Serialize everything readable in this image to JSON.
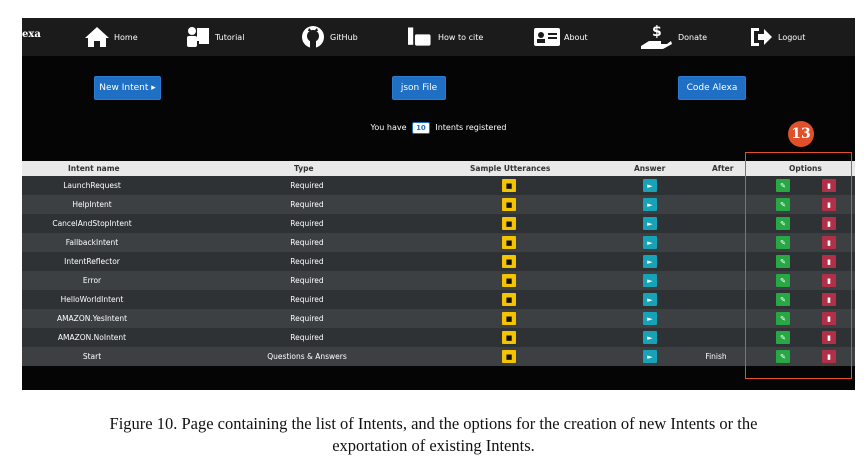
{
  "nav": {
    "brand": "exa",
    "items": [
      {
        "label": "Home",
        "icon": "home-icon"
      },
      {
        "label": "Tutorial",
        "icon": "tutorial-icon"
      },
      {
        "label": "GitHub",
        "icon": "github-icon"
      },
      {
        "label": "How to cite",
        "icon": "cite-icon"
      },
      {
        "label": "About",
        "icon": "about-card-icon"
      },
      {
        "label": "Donate",
        "icon": "donate-icon"
      },
      {
        "label": "Logout",
        "icon": "logout-icon"
      }
    ]
  },
  "actions": {
    "new_intent": "New Intent ▸",
    "json_file": "json File",
    "code_alexa": "Code Alexa"
  },
  "counter": {
    "prefix": "You have",
    "count": "10",
    "suffix": "Intents registered"
  },
  "table": {
    "headers": {
      "name": "Intent name",
      "type": "Type",
      "sample": "Sample Utterances",
      "answer": "Answer",
      "after": "After",
      "options": "Options"
    },
    "rows": [
      {
        "name": "LaunchRequest",
        "type": "Required",
        "after": ""
      },
      {
        "name": "HelpIntent",
        "type": "Required",
        "after": ""
      },
      {
        "name": "CancelAndStopIntent",
        "type": "Required",
        "after": ""
      },
      {
        "name": "FallbackIntent",
        "type": "Required",
        "after": ""
      },
      {
        "name": "IntentReflector",
        "type": "Required",
        "after": ""
      },
      {
        "name": "Error",
        "type": "Required",
        "after": ""
      },
      {
        "name": "HelloWorldIntent",
        "type": "Required",
        "after": ""
      },
      {
        "name": "AMAZON.YesIntent",
        "type": "Required",
        "after": ""
      },
      {
        "name": "AMAZON.NoIntent",
        "type": "Required",
        "after": ""
      },
      {
        "name": "Start",
        "type": "Questions & Answers",
        "after": "Finish"
      }
    ]
  },
  "annotation": {
    "marker": "13",
    "color": "#e0502a"
  },
  "caption": {
    "line1": "Figure 10. Page containing the list of Intents, and the options for the creation of new Intents or the",
    "line2": "exportation of existing Intents."
  },
  "colors": {
    "primary": "#1f6fc5",
    "sample_button": "#f5c400",
    "answer_button": "#17a2b8",
    "edit_button": "#28a745",
    "delete_button": "#b23047"
  }
}
